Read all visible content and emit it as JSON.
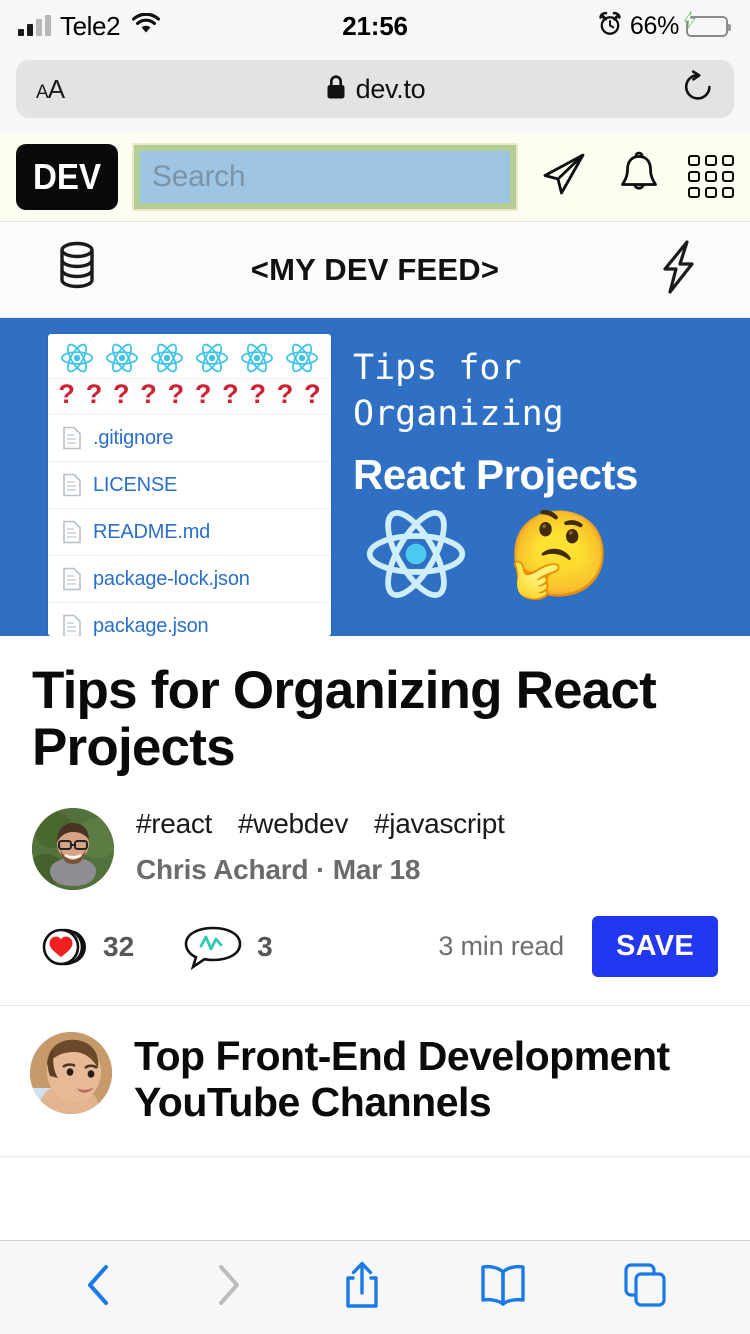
{
  "status_bar": {
    "carrier": "Tele2",
    "time": "21:56",
    "battery_percent": "66%",
    "battery_level": 66,
    "charging": true,
    "alarm_icon": "alarm-clock-icon",
    "wifi_icon": "wifi-icon",
    "signal_icon": "cellular-signal-icon"
  },
  "browser": {
    "text_size_button": "AA",
    "text_size_small": "A",
    "text_size_large": "A",
    "lock_icon": "lock-icon",
    "url": "dev.to",
    "reload_icon": "reload-icon",
    "toolbar": {
      "back": "back-chevron-icon",
      "forward": "forward-chevron-icon",
      "share": "share-icon",
      "bookmarks": "book-icon",
      "tabs": "tabs-icon"
    }
  },
  "site_header": {
    "logo_text": "DEV",
    "search": {
      "placeholder": "Search",
      "value": ""
    },
    "icons": [
      {
        "name": "paper-plane-icon",
        "label": "Write a post"
      },
      {
        "name": "bell-icon",
        "label": "Notifications"
      },
      {
        "name": "grid-icon",
        "label": "Menu"
      }
    ],
    "colors": {
      "background": "#fdfdf1",
      "search_border": "#b4cf96",
      "search_field": "#9ec5e4",
      "logo_background": "#0a0a0a"
    }
  },
  "feed_bar": {
    "left_icon": "database-stack-icon",
    "title": "<MY DEV FEED>",
    "right_icon": "lightning-bolt-icon"
  },
  "articles": [
    {
      "cover": {
        "background_color": "#2f70c4",
        "mono_line1": "Tips for",
        "mono_line2": "Organizing",
        "bold_line": "React Projects",
        "react_logo_count": 6,
        "question_mark_count": 10,
        "question_mark": "?",
        "files": [
          ".gitignore",
          "LICENSE",
          "README.md",
          "package-lock.json",
          "package.json"
        ],
        "emoji": "🤔"
      },
      "title": "Tips for Organizing React Projects",
      "tags": [
        "#react",
        "#webdev",
        "#javascript"
      ],
      "author": "Chris Achard",
      "separator": "·",
      "date": "Mar 18",
      "reactions_count": "32",
      "comments_count": "3",
      "read_time": "3 min read",
      "save_label": "SAVE",
      "save_color": "#2137f0",
      "reaction_icon": "heart-reaction-icon",
      "comment_icon": "comment-bubble-icon",
      "avatar_name": "author-avatar"
    },
    {
      "title": "Top Front-End Development YouTube Channels",
      "avatar_name": "author-avatar"
    }
  ]
}
